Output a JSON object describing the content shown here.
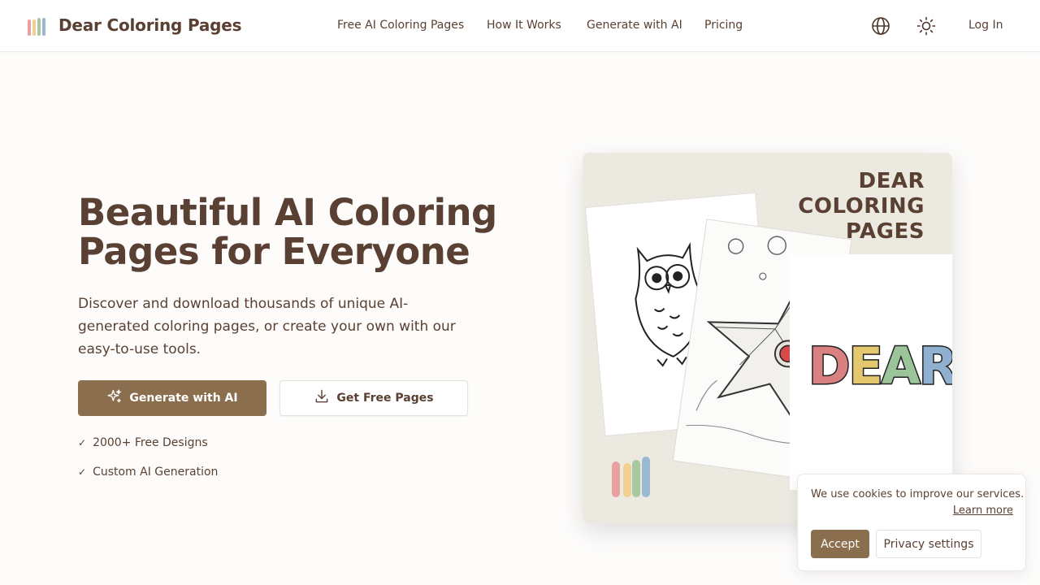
{
  "header": {
    "brand": "Dear Coloring Pages",
    "logo_colors": [
      "#e8a0a0",
      "#f0d090",
      "#a8c8a0",
      "#9ab8d0"
    ],
    "nav": [
      "Free AI Coloring Pages",
      "How It Works",
      "Generate with AI",
      "Pricing"
    ],
    "language_icon": "globe-icon",
    "theme_icon": "sun-icon",
    "login": "Log In"
  },
  "hero": {
    "title": "Beautiful AI Coloring Pages for Everyone",
    "subtitle": "Discover and download thousands of unique AI-generated coloring pages, or create your own with our easy-to-use tools.",
    "primary_button": "Generate with AI",
    "secondary_button": "Get Free Pages",
    "features": [
      "2000+ Free Designs",
      "Custom AI Generation"
    ],
    "check_glyph": "✓",
    "accent_color": "#8b6e4e"
  },
  "hero_image": {
    "title_lines": [
      "DEAR",
      "COLORING",
      "PAGES"
    ],
    "word": "DEAR"
  },
  "cookie": {
    "text": "We use cookies to improve our services.",
    "learn_more": "Learn more",
    "accept": "Accept",
    "privacy": "Privacy settings"
  }
}
